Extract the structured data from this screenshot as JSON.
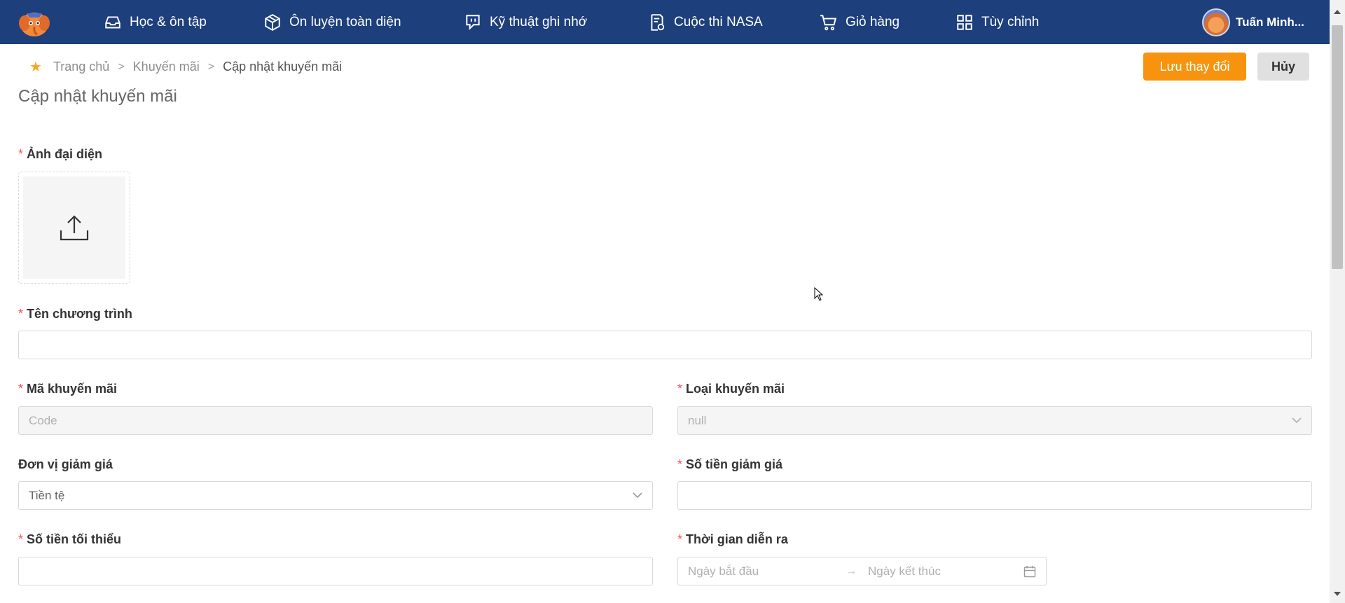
{
  "nav": {
    "items": [
      {
        "label": "Học & ôn tập",
        "icon": "inbox-icon"
      },
      {
        "label": "Ôn luyện toàn diện",
        "icon": "cube-icon"
      },
      {
        "label": "Kỹ thuật ghi nhớ",
        "icon": "chat-bubble-icon"
      },
      {
        "label": "Cuộc thi NASA",
        "icon": "document-badge-icon"
      },
      {
        "label": "Giỏ hàng",
        "icon": "cart-icon"
      },
      {
        "label": "Tùy chỉnh",
        "icon": "grid-icon"
      }
    ],
    "user_name": "Tuấn Minh..."
  },
  "breadcrumb": {
    "home": "Trang chủ",
    "section": "Khuyến mãi",
    "current": "Cập nhật khuyến mãi",
    "separator": ">"
  },
  "actions": {
    "save_label": "Lưu thay đổi",
    "cancel_label": "Hủy"
  },
  "page_title": "Cập nhật khuyến mãi",
  "form": {
    "required_mark": "*",
    "avatar_label": "Ảnh đại diện",
    "program_name_label": "Tên chương trình",
    "program_name_value": "",
    "promo_code_label": "Mã khuyến mãi",
    "promo_code_placeholder": "Code",
    "promo_type_label": "Loại khuyến mãi",
    "promo_type_value": "null",
    "discount_unit_label": "Đơn vị giảm giá",
    "discount_unit_value": "Tiền tệ",
    "discount_amount_label": "Số tiền giảm giá",
    "discount_amount_value": "",
    "min_amount_label": "Số tiền tối thiểu",
    "min_amount_value": "",
    "duration_label": "Thời gian diễn ra",
    "start_date_placeholder": "Ngày bắt đầu",
    "end_date_placeholder": "Ngày kết thúc",
    "range_arrow": "→"
  },
  "colors": {
    "nav_bg": "#1d3f7c",
    "accent": "#f7930e",
    "required": "#ff4d4f"
  }
}
